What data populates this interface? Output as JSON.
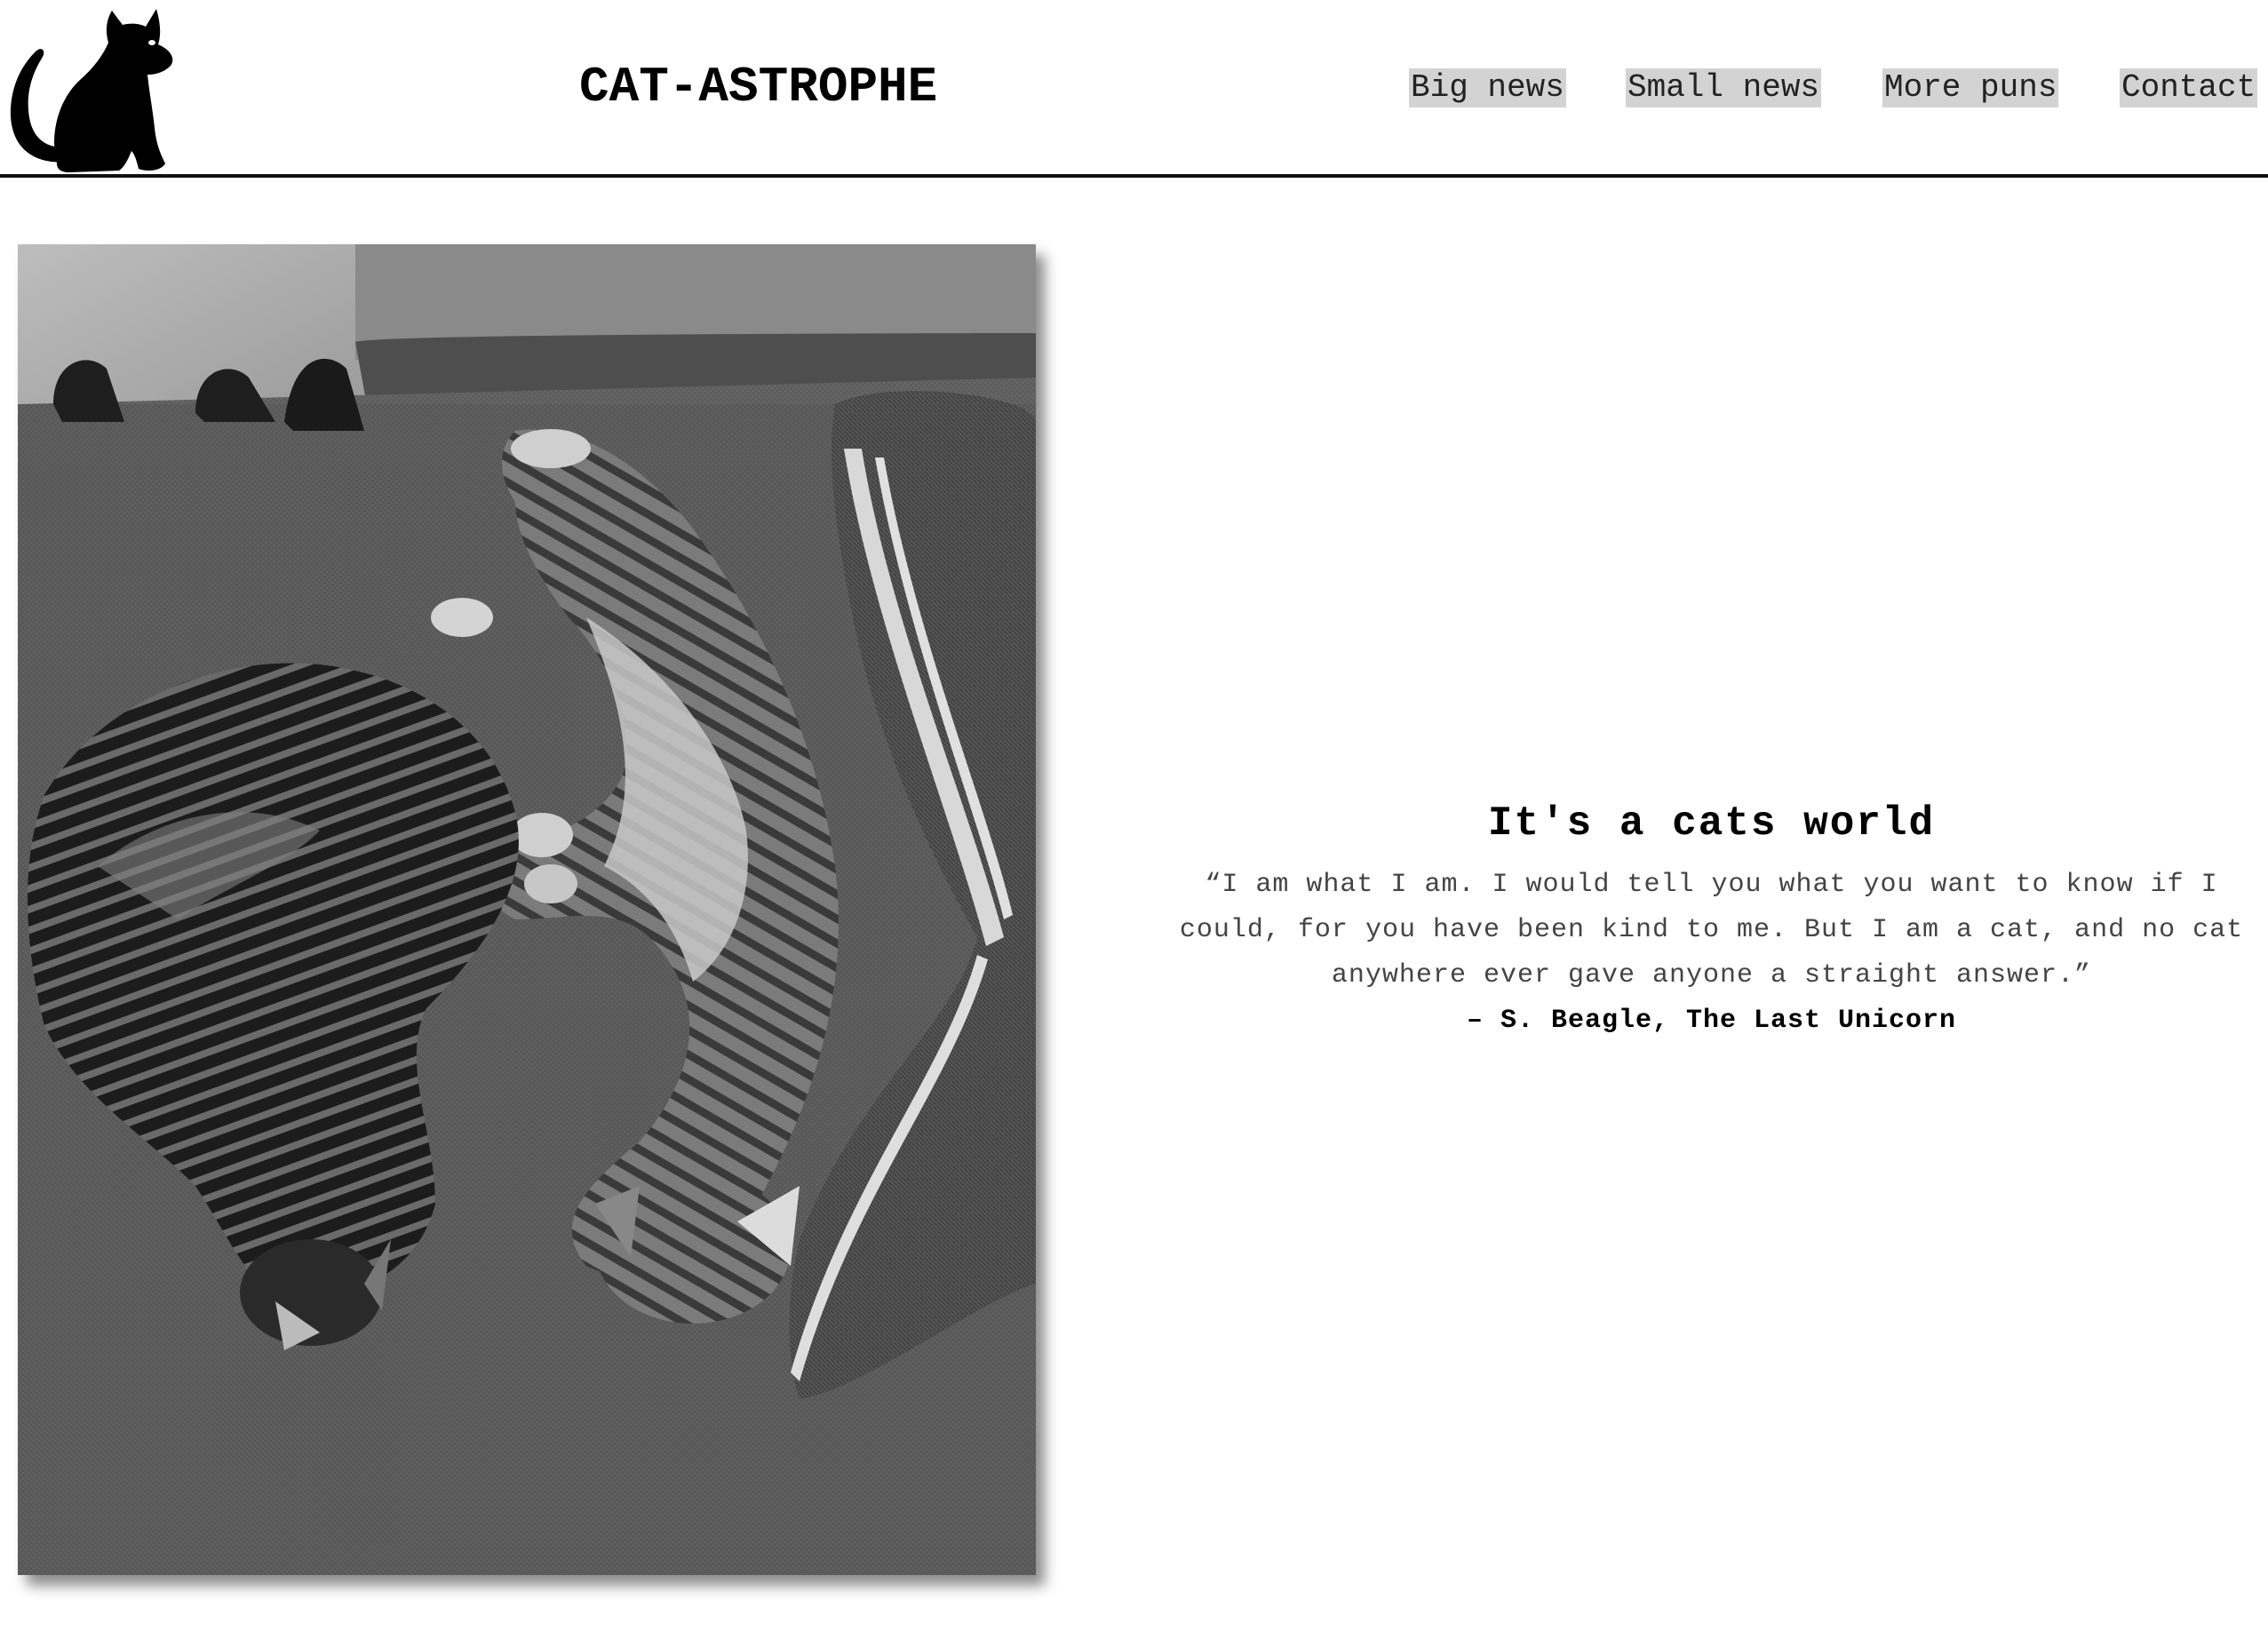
{
  "header": {
    "logo_icon": "black-cat-silhouette-icon",
    "title": "CAT-ASTROPHE"
  },
  "nav": {
    "items": [
      {
        "label": "Big news"
      },
      {
        "label": "Small news"
      },
      {
        "label": "More puns"
      },
      {
        "label": "Contact"
      }
    ],
    "link_background": "#d3d3d3"
  },
  "photo": {
    "icon": "two-sleeping-kittens-photo"
  },
  "quote": {
    "heading": "It's a cats world",
    "text": "“I am what I am. I would tell you what you want to know if I could, for you have been kind to me. But I am a cat, and no cat anywhere ever gave anyone a straight answer.”",
    "attribution": "– S. Beagle, The Last Unicorn"
  }
}
